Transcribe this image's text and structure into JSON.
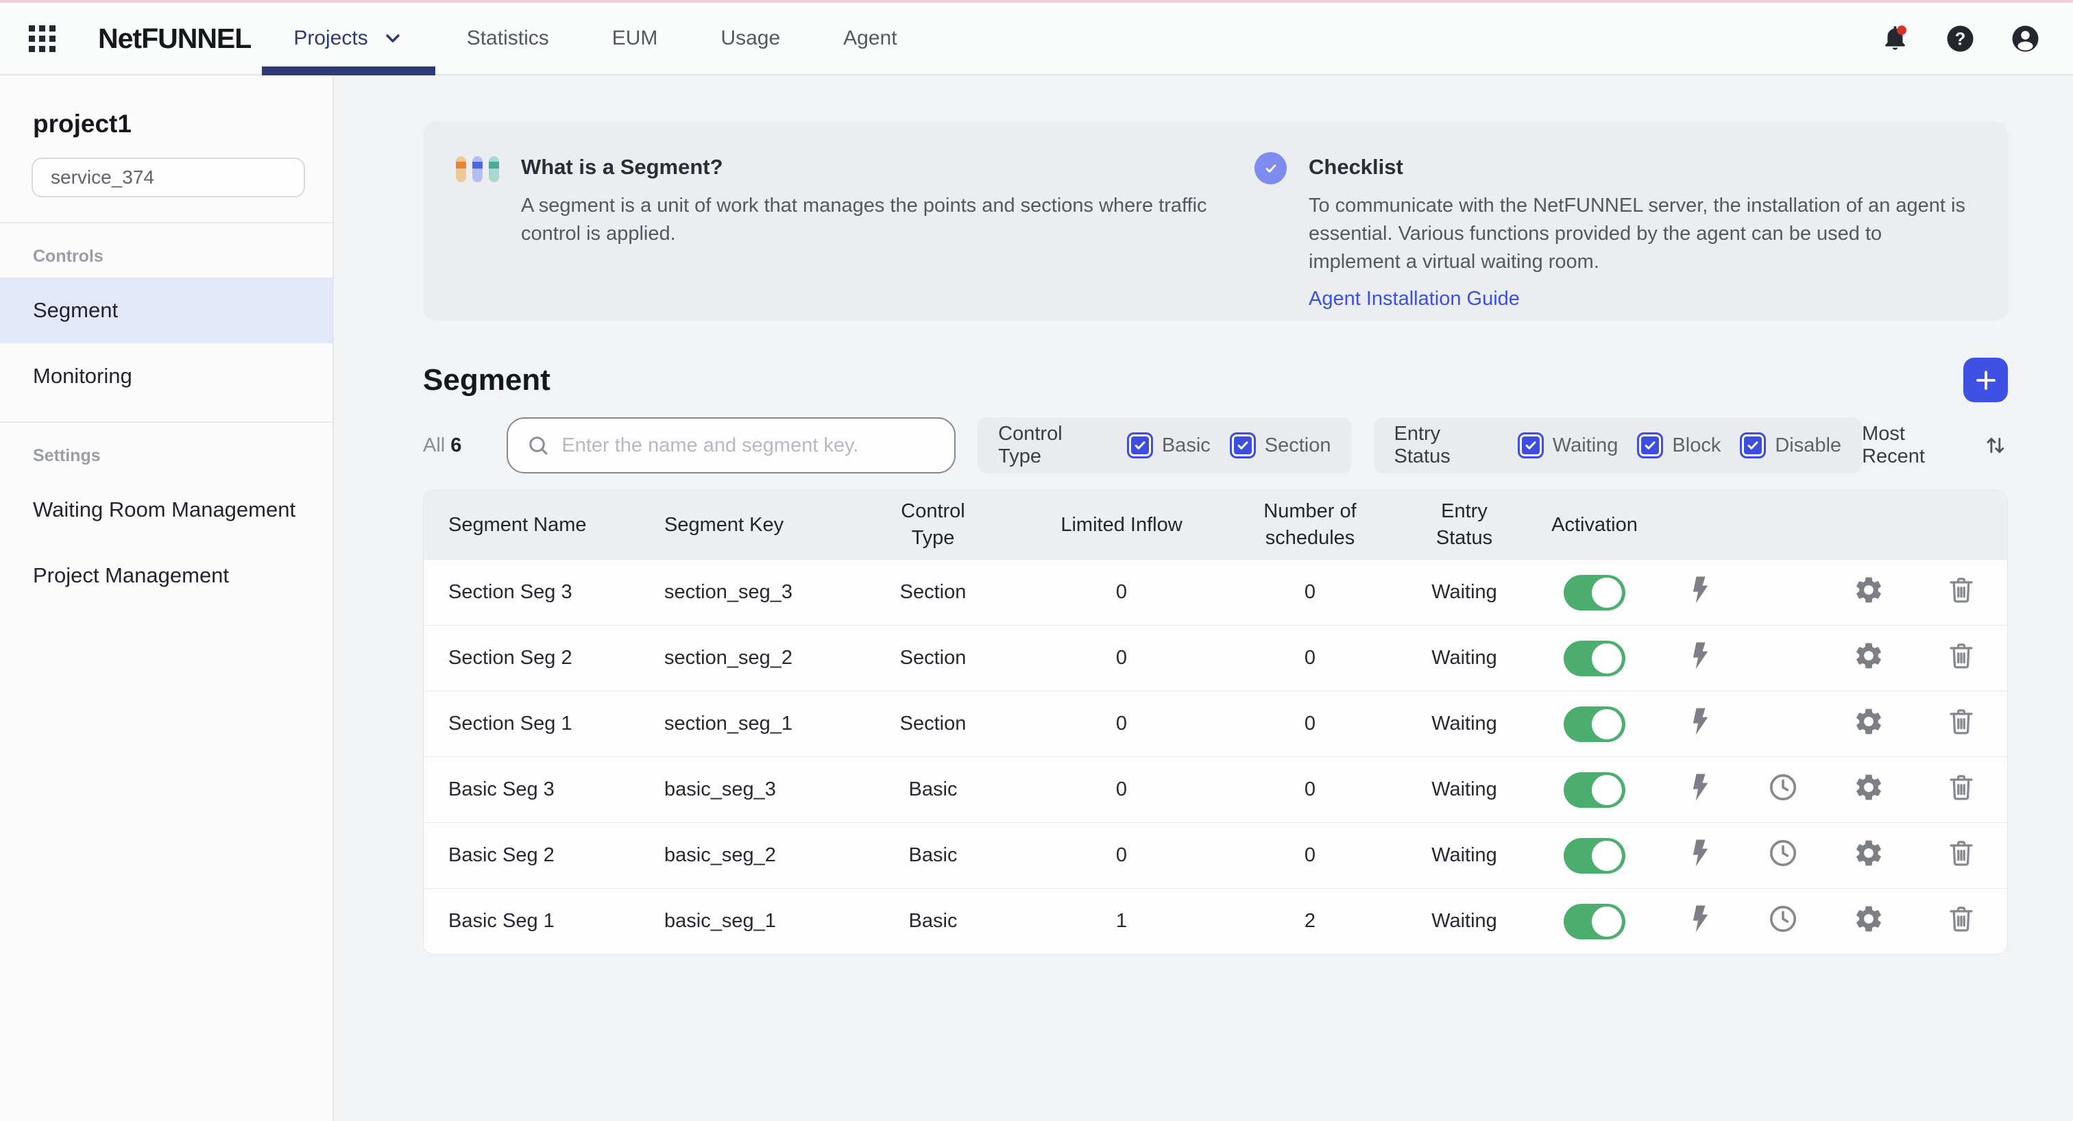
{
  "header": {
    "logo": "NetFUNNEL",
    "nav": [
      {
        "label": "Projects",
        "active": true,
        "has_dropdown": true
      },
      {
        "label": "Statistics"
      },
      {
        "label": "EUM"
      },
      {
        "label": "Usage"
      },
      {
        "label": "Agent"
      }
    ],
    "icons": [
      "apps-grid-icon",
      "bell-icon",
      "help-icon",
      "account-icon"
    ],
    "notification_badge": true
  },
  "sidebar": {
    "project_name": "project1",
    "service_selector": "service_374",
    "sections": [
      {
        "label": "Controls",
        "items": [
          {
            "label": "Segment",
            "active": true
          },
          {
            "label": "Monitoring",
            "active": false
          }
        ]
      },
      {
        "label": "Settings",
        "items": [
          {
            "label": "Waiting Room Management",
            "active": false
          },
          {
            "label": "Project Management",
            "active": false
          }
        ]
      }
    ]
  },
  "banner": {
    "segment_info": {
      "icon": "segment-pills-icon",
      "title": "What is a Segment?",
      "description": "A segment is a unit of work that manages the points and sections where traffic control is applied."
    },
    "checklist": {
      "icon": "check-circle-icon",
      "title": "Checklist",
      "description": "To communicate with the NetFUNNEL server, the installation of an agent is essential. Various functions provided by the agent can be used to implement a virtual waiting room.",
      "link": "Agent Installation Guide"
    }
  },
  "toolbar": {
    "title": "Segment",
    "count_label": "All",
    "count_value": "6",
    "search_placeholder": "Enter the name and segment key.",
    "filters": {
      "control_type": {
        "label": "Control Type",
        "options": [
          {
            "label": "Basic",
            "checked": true
          },
          {
            "label": "Section",
            "checked": true
          }
        ]
      },
      "entry_status": {
        "label": "Entry Status",
        "options": [
          {
            "label": "Waiting",
            "checked": true
          },
          {
            "label": "Block",
            "checked": true
          },
          {
            "label": "Disable",
            "checked": true
          }
        ]
      }
    },
    "sort_label": "Most Recent",
    "sort_icon": "sort-arrows-icon",
    "add_icon": "plus-icon"
  },
  "table": {
    "columns": [
      "Segment Name",
      "Segment Key",
      "Control Type",
      "Limited Inflow",
      "Number of schedules",
      "Entry Status",
      "Activation"
    ],
    "row_action_icons": [
      "lightning-icon",
      "clock-icon",
      "gear-icon",
      "trash-icon"
    ],
    "rows": [
      {
        "name": "Section Seg 3",
        "key": "section_seg_3",
        "control_type": "Section",
        "limited_inflow": "0",
        "schedules": "0",
        "entry_status": "Waiting",
        "activation": true,
        "has_schedule_icon": false
      },
      {
        "name": "Section Seg 2",
        "key": "section_seg_2",
        "control_type": "Section",
        "limited_inflow": "0",
        "schedules": "0",
        "entry_status": "Waiting",
        "activation": true,
        "has_schedule_icon": false
      },
      {
        "name": "Section Seg 1",
        "key": "section_seg_1",
        "control_type": "Section",
        "limited_inflow": "0",
        "schedules": "0",
        "entry_status": "Waiting",
        "activation": true,
        "has_schedule_icon": false
      },
      {
        "name": "Basic Seg 3",
        "key": "basic_seg_3",
        "control_type": "Basic",
        "limited_inflow": "0",
        "schedules": "0",
        "entry_status": "Waiting",
        "activation": true,
        "has_schedule_icon": true
      },
      {
        "name": "Basic Seg 2",
        "key": "basic_seg_2",
        "control_type": "Basic",
        "limited_inflow": "0",
        "schedules": "0",
        "entry_status": "Waiting",
        "activation": true,
        "has_schedule_icon": true
      },
      {
        "name": "Basic Seg 1",
        "key": "basic_seg_1",
        "control_type": "Basic",
        "limited_inflow": "1",
        "schedules": "2",
        "entry_status": "Waiting",
        "activation": true,
        "has_schedule_icon": true
      }
    ]
  },
  "colors": {
    "accent_blue": "#3F51E3",
    "nav_active_navy": "#2D3A75",
    "toggle_on_green": "#4CAE6E",
    "link_blue": "#3B4FE0",
    "badge_red": "#D93025",
    "active_sidebar_bg": "#E4E7F8",
    "banner_bg": "#EBEDF0",
    "table_header_bg": "#ECEEF1",
    "top_strip_pink": "#F6CDD4"
  }
}
